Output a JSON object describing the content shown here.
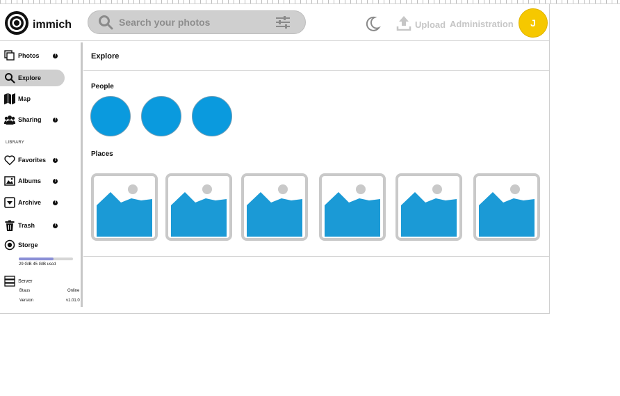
{
  "app": {
    "name": "immich"
  },
  "header": {
    "search_placeholder": "Search your photos",
    "upload_label": "Upload",
    "admin_label": "Administration",
    "avatar_initial": "J"
  },
  "sidebar": {
    "items": [
      {
        "label": "Photos",
        "icon": "photos-icon",
        "info": true
      },
      {
        "label": "Explore",
        "icon": "search-icon",
        "info": false,
        "active": true
      },
      {
        "label": "Map",
        "icon": "map-icon",
        "info": false
      },
      {
        "label": "Sharing",
        "icon": "people-icon",
        "info": true
      }
    ],
    "library_heading": "LIBRARY",
    "library_items": [
      {
        "label": "Favorites",
        "icon": "heart-icon",
        "info": true
      },
      {
        "label": "Albums",
        "icon": "image-icon",
        "info": true
      },
      {
        "label": "Archive",
        "icon": "archive-icon",
        "info": true
      },
      {
        "label": "Trash",
        "icon": "trash-icon",
        "info": true
      }
    ],
    "storage": {
      "label": "Storge",
      "usage_text": "29 GIB 45 GIB uscd",
      "fill_fraction": 0.64
    },
    "server": {
      "label": "Server",
      "status_label": "Btaus",
      "status_value": "Online",
      "version_label": "Version",
      "version_value": "v1.01.0"
    }
  },
  "main": {
    "title": "Explore",
    "people_heading": "People",
    "places_heading": "Places"
  },
  "colors": {
    "accent": "#0a9ade",
    "avatar": "#f6c800",
    "storage_fill": "#8a8fd6"
  }
}
